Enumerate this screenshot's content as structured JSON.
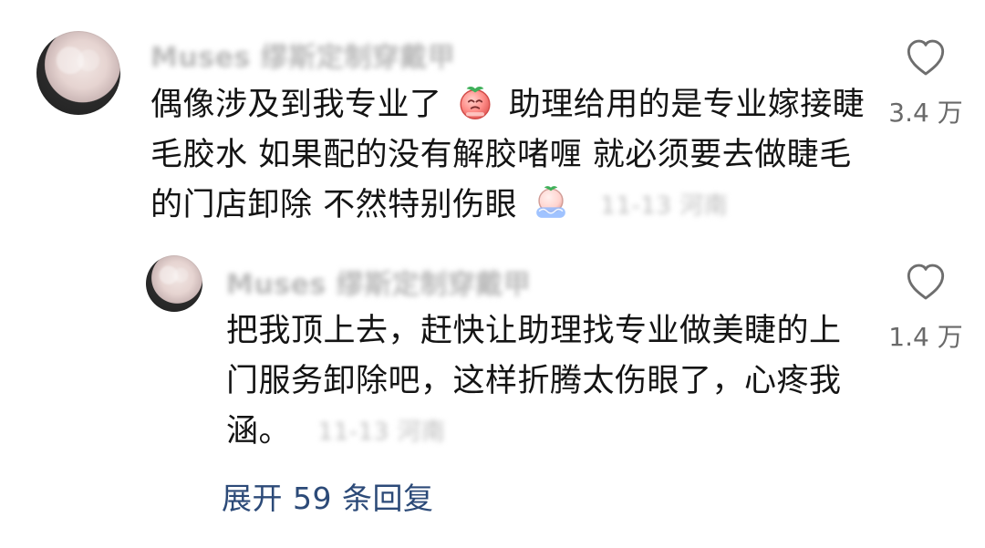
{
  "comments": [
    {
      "author": "Muses 缪斯定制穿戴甲",
      "text_line1_a": "偶像涉及到我专业了",
      "text_line1_b": "助理给用的是专业嫁接睫",
      "text_line2": "毛胶水 如果配的没有解胶啫喱 就必须要去做睫毛",
      "text_line3": "的门店卸除 不然特别伤眼",
      "meta": "11-13 河南",
      "likes": "3.4 万",
      "emoji_1": "crying-peach-emoji",
      "emoji_2": "sobbing-peach-emoji"
    },
    {
      "author": "Muses 缪斯定制穿戴甲",
      "text_line1": "把我顶上去，赶快让助理找专业做美睫的上",
      "text_line2": "门服务卸除吧，这样折腾太伤眼了，心疼我",
      "text_line3": "涵。",
      "meta": "11-13 河南",
      "likes": "1.4 万"
    }
  ],
  "expand_replies": "展开 59 条回复",
  "colors": {
    "text": "#141414",
    "muted": "#bdbdbd",
    "link": "#2c4a78",
    "icon": "#6e6e6e"
  }
}
